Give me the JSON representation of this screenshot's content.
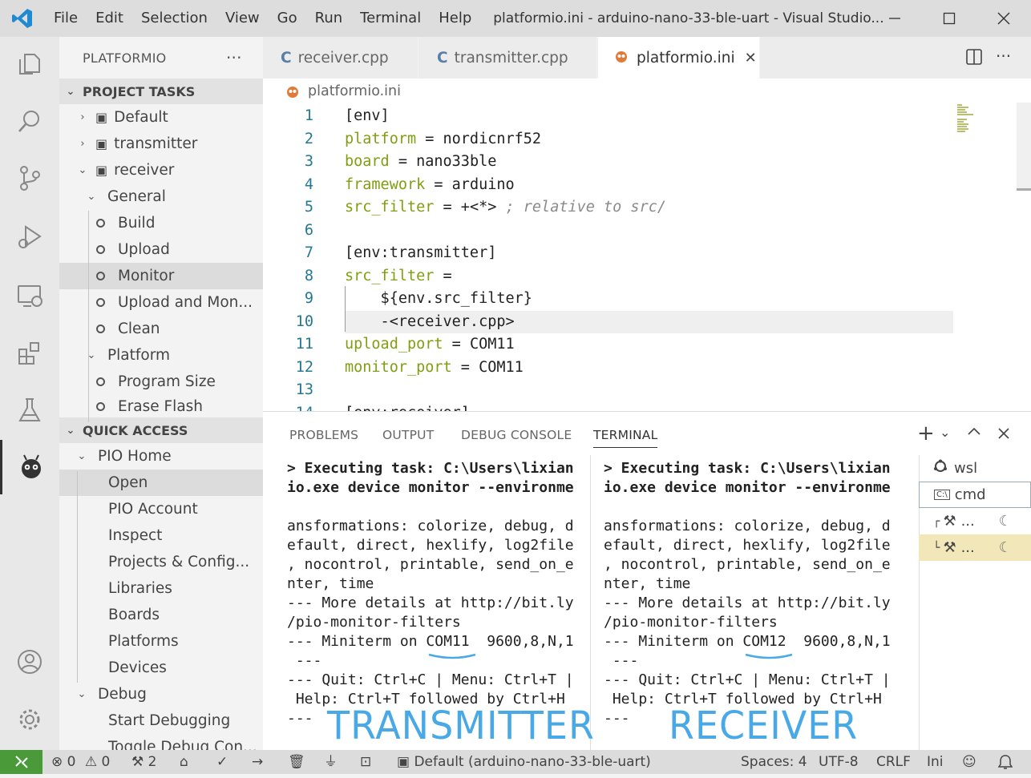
{
  "window": {
    "menu": [
      "File",
      "Edit",
      "Selection",
      "View",
      "Go",
      "Run",
      "Terminal",
      "Help"
    ],
    "title": "platformio.ini - arduino-nano-33-ble-uart - Visual Studio...",
    "controls": [
      "—",
      "☐",
      "✕"
    ],
    "accent": "#0065a9"
  },
  "activity_bar": {
    "icons": [
      "files-icon",
      "search-icon",
      "source-control-icon",
      "run-debug-icon",
      "remote-explorer-icon",
      "extensions-icon",
      "testing-icon",
      "platformio-icon",
      "accounts-icon",
      "settings-gear-icon"
    ]
  },
  "sidebar": {
    "title": "PLATFORMIO",
    "more": "···",
    "project_tasks": {
      "label": "PROJECT TASKS",
      "envs": [
        "Default",
        "transmitter",
        "receiver"
      ],
      "general": {
        "label": "General",
        "items": [
          "Build",
          "Upload",
          "Monitor",
          "Upload and Mon...",
          "Clean"
        ]
      },
      "platform": {
        "label": "Platform",
        "items": [
          "Program Size",
          "Erase Flash"
        ]
      }
    },
    "quick_access": {
      "label": "QUICK ACCESS",
      "pio_home": {
        "label": "PIO Home",
        "items": [
          "Open",
          "PIO Account",
          "Inspect",
          "Projects & Config...",
          "Libraries",
          "Boards",
          "Platforms",
          "Devices"
        ]
      },
      "debug": {
        "label": "Debug",
        "items": [
          "Start Debugging",
          "Toggle Debug Con..."
        ]
      }
    }
  },
  "tabs": [
    {
      "label": "receiver.cpp",
      "icon": "C"
    },
    {
      "label": "transmitter.cpp",
      "icon": "C"
    },
    {
      "label": "platformio.ini",
      "icon": "pio",
      "close": "✕"
    }
  ],
  "editor": {
    "breadcrumb": "platformio.ini",
    "lines": [
      {
        "n": "1",
        "key": "",
        "rest": "[env]",
        "cmt": ""
      },
      {
        "n": "2",
        "key": "platform",
        "rest": " = nordicnrf52",
        "cmt": ""
      },
      {
        "n": "3",
        "key": "board",
        "rest": " = nano33ble",
        "cmt": ""
      },
      {
        "n": "4",
        "key": "framework",
        "rest": " = arduino",
        "cmt": ""
      },
      {
        "n": "5",
        "key": "src_filter",
        "rest": " = +<*> ",
        "cmt": "; relative to src/"
      },
      {
        "n": "6",
        "key": "",
        "rest": "",
        "cmt": ""
      },
      {
        "n": "7",
        "key": "",
        "rest": "[env:transmitter]",
        "cmt": ""
      },
      {
        "n": "8",
        "key": "src_filter",
        "rest": " =",
        "cmt": ""
      },
      {
        "n": "9",
        "key": "",
        "rest": "    ${env.src_filter}",
        "cmt": ""
      },
      {
        "n": "10",
        "key": "",
        "rest": "    -<receiver.cpp>",
        "cmt": ""
      },
      {
        "n": "11",
        "key": "upload_port",
        "rest": " = COM11",
        "cmt": ""
      },
      {
        "n": "12",
        "key": "monitor_port",
        "rest": " = COM11",
        "cmt": ""
      },
      {
        "n": "13",
        "key": "",
        "rest": "",
        "cmt": ""
      },
      {
        "n": "14",
        "key": "",
        "rest": "[env:receiver]",
        "cmt": ""
      }
    ]
  },
  "panel": {
    "tabs": [
      "PROBLEMS",
      "OUTPUT",
      "DEBUG CONSOLE",
      "TERMINAL"
    ],
    "active_tab": "TERMINAL",
    "actions": [
      "+",
      "⌄",
      "^",
      "✕"
    ],
    "terminal_left": [
      "> Executing task: C:\\Users\\lixian",
      "io.exe device monitor --environme",
      "",
      "ansformations: colorize, debug, d",
      "efault, direct, hexlify, log2file",
      ", nocontrol, printable, send_on_e",
      "nter, time",
      "--- More details at http://bit.ly",
      "/pio-monitor-filters",
      "--- Miniterm on COM11  9600,8,N,1",
      " ---",
      "--- Quit: Ctrl+C | Menu: Ctrl+T |",
      " Help: Ctrl+T followed by Ctrl+H",
      "---"
    ],
    "terminal_right": [
      "> Executing task: C:\\Users\\lixian",
      "io.exe device monitor --environme",
      "",
      "ansformations: colorize, debug, d",
      "efault, direct, hexlify, log2file",
      ", nocontrol, printable, send_on_e",
      "nter, time",
      "--- More details at http://bit.ly",
      "/pio-monitor-filters",
      "--- Miniterm on COM12  9600,8,N,1",
      " ---",
      "--- Quit: Ctrl+C | Menu: Ctrl+T |",
      " Help: Ctrl+T followed by Ctrl+H",
      "---"
    ],
    "annotation_left": "TRANSMITTER",
    "annotation_right": "RECEIVER",
    "terminal_list": [
      "wsl",
      "cmd",
      "...",
      "..."
    ]
  },
  "statusbar": {
    "remote": "⚡",
    "errors": "0",
    "warnings": "0",
    "tasks": "2",
    "env": "Default (arduino-nano-33-ble-uart)",
    "spaces": "Spaces: 4",
    "encoding": "UTF-8",
    "eol": "CRLF",
    "lang": "Ini",
    "remote_bg": "#4a9a3a"
  }
}
